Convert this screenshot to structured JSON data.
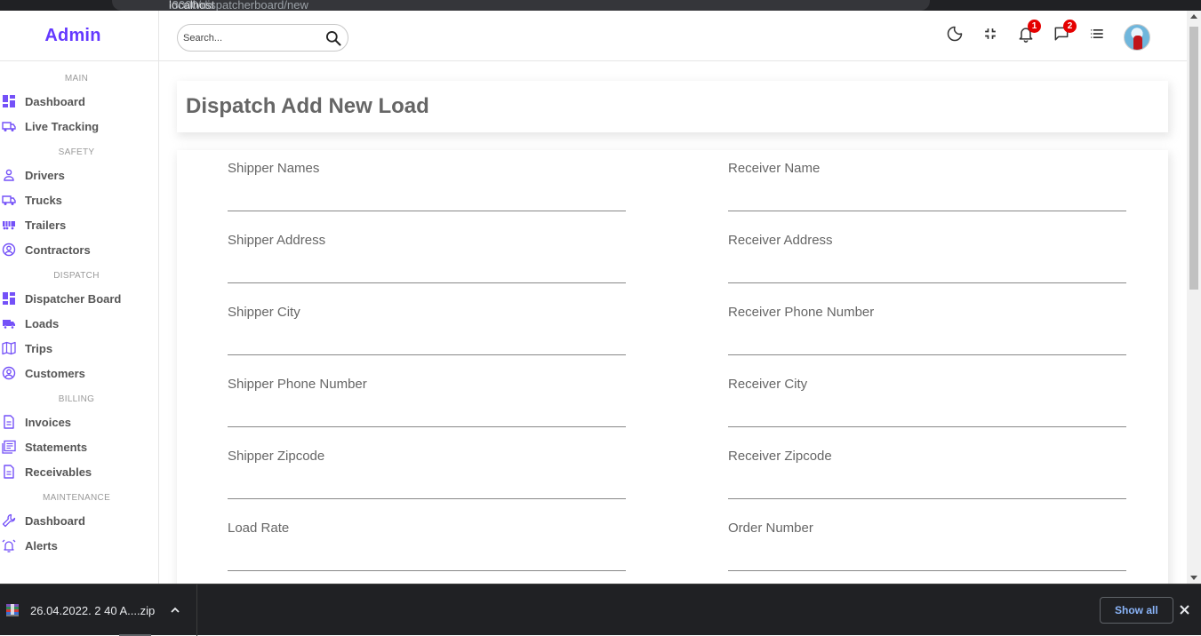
{
  "browser": {
    "url_host": "localhost",
    "url_path": ":3000/dispatcherboard/new"
  },
  "sidebar": {
    "logo": "Admin",
    "sections": [
      {
        "title": "MAIN",
        "items": [
          {
            "label": "Dashboard",
            "icon": "dashboard-icon"
          },
          {
            "label": "Live Tracking",
            "icon": "truck-icon"
          }
        ]
      },
      {
        "title": "SAFETY",
        "items": [
          {
            "label": "Drivers",
            "icon": "person-icon"
          },
          {
            "label": "Trucks",
            "icon": "truck-icon"
          },
          {
            "label": "Trailers",
            "icon": "trailer-icon"
          },
          {
            "label": "Contractors",
            "icon": "account-circle-icon"
          }
        ]
      },
      {
        "title": "DISPATCH",
        "items": [
          {
            "label": "Dispatcher Board",
            "icon": "dashboard-icon"
          },
          {
            "label": "Loads",
            "icon": "local-shipping-icon"
          },
          {
            "label": "Trips",
            "icon": "map-icon"
          },
          {
            "label": "Customers",
            "icon": "account-circle-icon"
          }
        ]
      },
      {
        "title": "BILLING",
        "items": [
          {
            "label": "Invoices",
            "icon": "document-icon"
          },
          {
            "label": "Statements",
            "icon": "statement-icon"
          },
          {
            "label": "Receivables",
            "icon": "document-icon"
          }
        ]
      },
      {
        "title": "MAINTENANCE",
        "items": [
          {
            "label": "Dashboard",
            "icon": "wrench-icon"
          },
          {
            "label": "Alerts",
            "icon": "alarm-icon"
          }
        ]
      }
    ]
  },
  "topbar": {
    "search_placeholder": "Search...",
    "notifications_count": "1",
    "messages_count": "2"
  },
  "page": {
    "title": "Dispatch Add New Load"
  },
  "form": {
    "left": [
      "Shipper Names",
      "Shipper Address",
      "Shipper City",
      "Shipper Phone Number",
      "Shipper Zipcode",
      "Load Rate"
    ],
    "right": [
      "Receiver Name",
      "Receiver Address",
      "Receiver Phone Number",
      "Receiver City",
      "Receiver Zipcode",
      "Order Number"
    ]
  },
  "download_bar": {
    "file_name": "26.04.2022. 2 40 A....zip",
    "show_all_label": "Show all"
  },
  "colors": {
    "accent": "#6439ff",
    "icon": "#7451f8",
    "badge": "#e50000"
  }
}
